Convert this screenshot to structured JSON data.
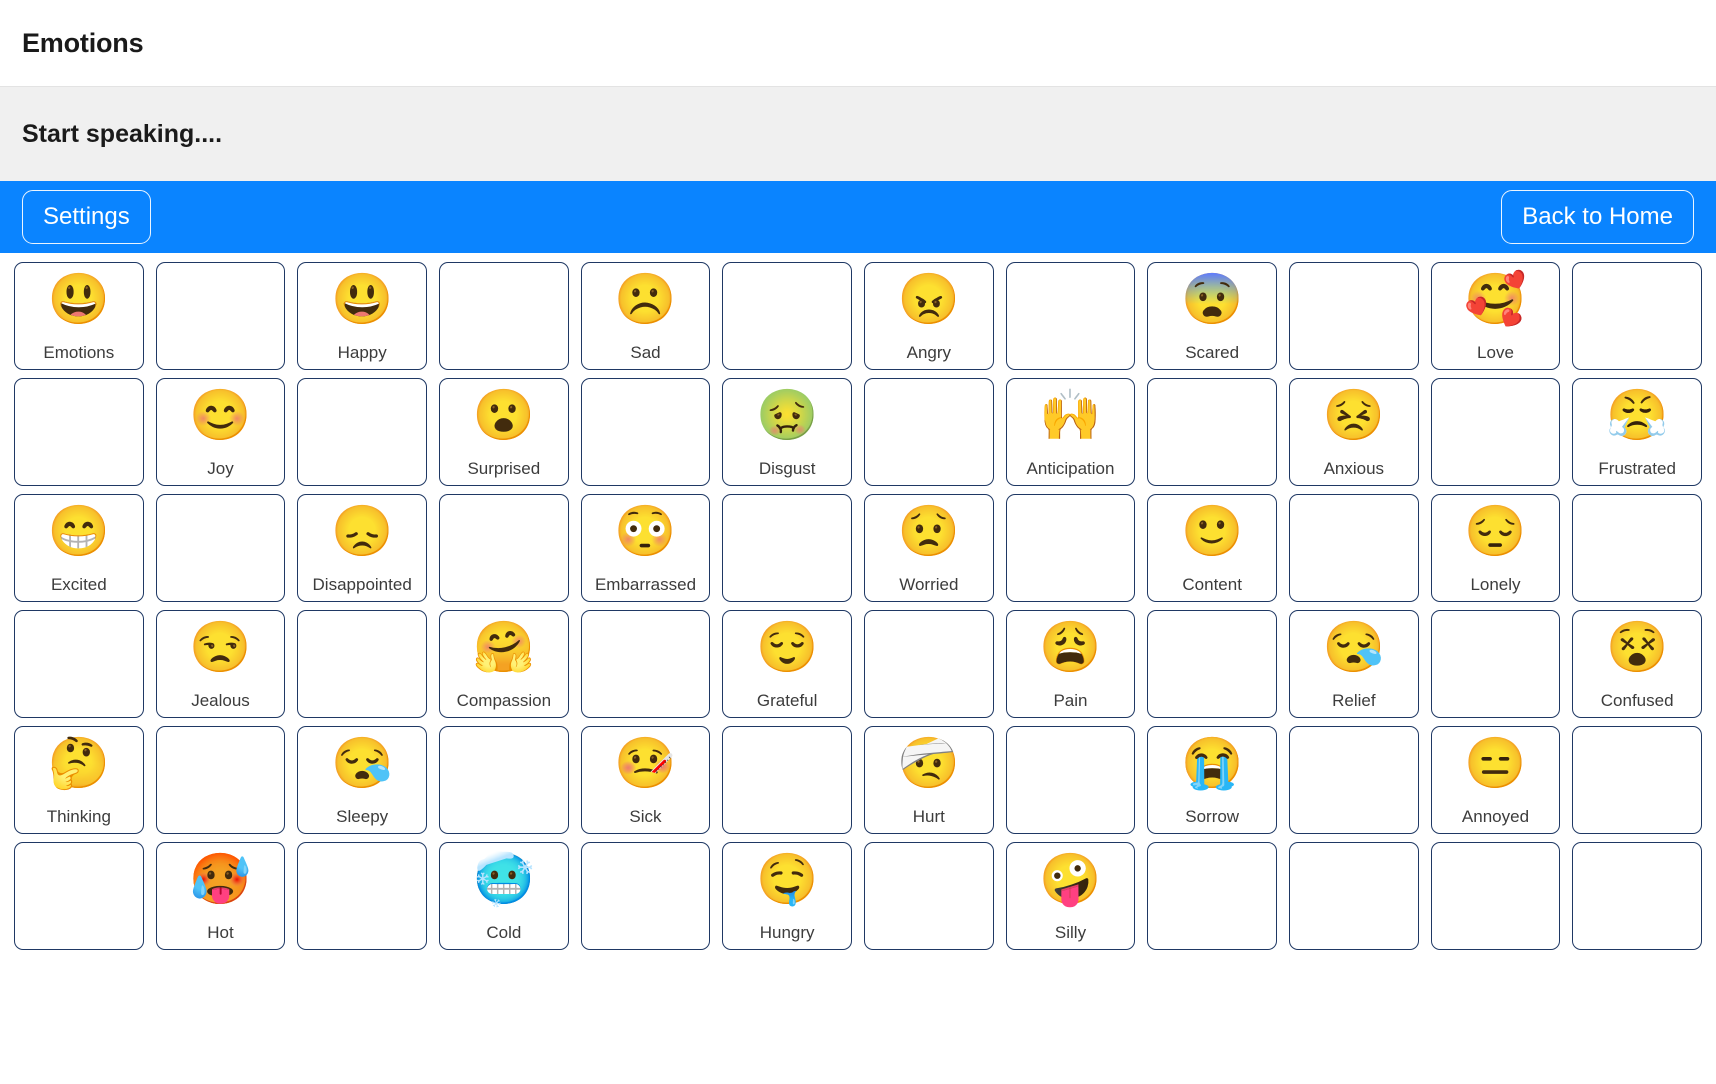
{
  "window": {
    "title": "Emotions"
  },
  "status": {
    "text": "Start speaking...."
  },
  "toolbar": {
    "settings_label": "Settings",
    "back_home_label": "Back to Home",
    "accent_color": "#0a84ff"
  },
  "grid": {
    "columns": 12,
    "rows": 6,
    "cell_border_color": "#1f3864",
    "cells": [
      {
        "label": "Emotions",
        "glyph": "😃"
      },
      {
        "label": "",
        "glyph": ""
      },
      {
        "label": "Happy",
        "glyph": "😃"
      },
      {
        "label": "",
        "glyph": ""
      },
      {
        "label": "Sad",
        "glyph": "☹️"
      },
      {
        "label": "",
        "glyph": ""
      },
      {
        "label": "Angry",
        "glyph": "😠"
      },
      {
        "label": "",
        "glyph": ""
      },
      {
        "label": "Scared",
        "glyph": "😨"
      },
      {
        "label": "",
        "glyph": ""
      },
      {
        "label": "Love",
        "glyph": "🥰"
      },
      {
        "label": "",
        "glyph": ""
      },
      {
        "label": "",
        "glyph": ""
      },
      {
        "label": "Joy",
        "glyph": "😊"
      },
      {
        "label": "",
        "glyph": ""
      },
      {
        "label": "Surprised",
        "glyph": "😮"
      },
      {
        "label": "",
        "glyph": ""
      },
      {
        "label": "Disgust",
        "glyph": "🤢"
      },
      {
        "label": "",
        "glyph": ""
      },
      {
        "label": "Anticipation",
        "glyph": "🙌"
      },
      {
        "label": "",
        "glyph": ""
      },
      {
        "label": "Anxious",
        "glyph": "😣"
      },
      {
        "label": "",
        "glyph": ""
      },
      {
        "label": "Frustrated",
        "glyph": "😤"
      },
      {
        "label": "Excited",
        "glyph": "😁"
      },
      {
        "label": "",
        "glyph": ""
      },
      {
        "label": "Disappointed",
        "glyph": "😞"
      },
      {
        "label": "",
        "glyph": ""
      },
      {
        "label": "Embarrassed",
        "glyph": "😳"
      },
      {
        "label": "",
        "glyph": ""
      },
      {
        "label": "Worried",
        "glyph": "😟"
      },
      {
        "label": "",
        "glyph": ""
      },
      {
        "label": "Content",
        "glyph": "🙂"
      },
      {
        "label": "",
        "glyph": ""
      },
      {
        "label": "Lonely",
        "glyph": "😔"
      },
      {
        "label": "",
        "glyph": ""
      },
      {
        "label": "",
        "glyph": ""
      },
      {
        "label": "Jealous",
        "glyph": "😒"
      },
      {
        "label": "",
        "glyph": ""
      },
      {
        "label": "Compassion",
        "glyph": "🤗"
      },
      {
        "label": "",
        "glyph": ""
      },
      {
        "label": "Grateful",
        "glyph": "😌"
      },
      {
        "label": "",
        "glyph": ""
      },
      {
        "label": "Pain",
        "glyph": "😩"
      },
      {
        "label": "",
        "glyph": ""
      },
      {
        "label": "Relief",
        "glyph": "😪"
      },
      {
        "label": "",
        "glyph": ""
      },
      {
        "label": "Confused",
        "glyph": "😵"
      },
      {
        "label": "Thinking",
        "glyph": "🤔"
      },
      {
        "label": "",
        "glyph": ""
      },
      {
        "label": "Sleepy",
        "glyph": "😪"
      },
      {
        "label": "",
        "glyph": ""
      },
      {
        "label": "Sick",
        "glyph": "🤒"
      },
      {
        "label": "",
        "glyph": ""
      },
      {
        "label": "Hurt",
        "glyph": "🤕"
      },
      {
        "label": "",
        "glyph": ""
      },
      {
        "label": "Sorrow",
        "glyph": "😭"
      },
      {
        "label": "",
        "glyph": ""
      },
      {
        "label": "Annoyed",
        "glyph": "😑"
      },
      {
        "label": "",
        "glyph": ""
      },
      {
        "label": "",
        "glyph": ""
      },
      {
        "label": "Hot",
        "glyph": "🥵"
      },
      {
        "label": "",
        "glyph": ""
      },
      {
        "label": "Cold",
        "glyph": "🥶"
      },
      {
        "label": "",
        "glyph": ""
      },
      {
        "label": "Hungry",
        "glyph": "🤤"
      },
      {
        "label": "",
        "glyph": ""
      },
      {
        "label": "Silly",
        "glyph": "🤪"
      },
      {
        "label": "",
        "glyph": ""
      },
      {
        "label": "",
        "glyph": ""
      },
      {
        "label": "",
        "glyph": ""
      },
      {
        "label": "",
        "glyph": ""
      }
    ]
  }
}
